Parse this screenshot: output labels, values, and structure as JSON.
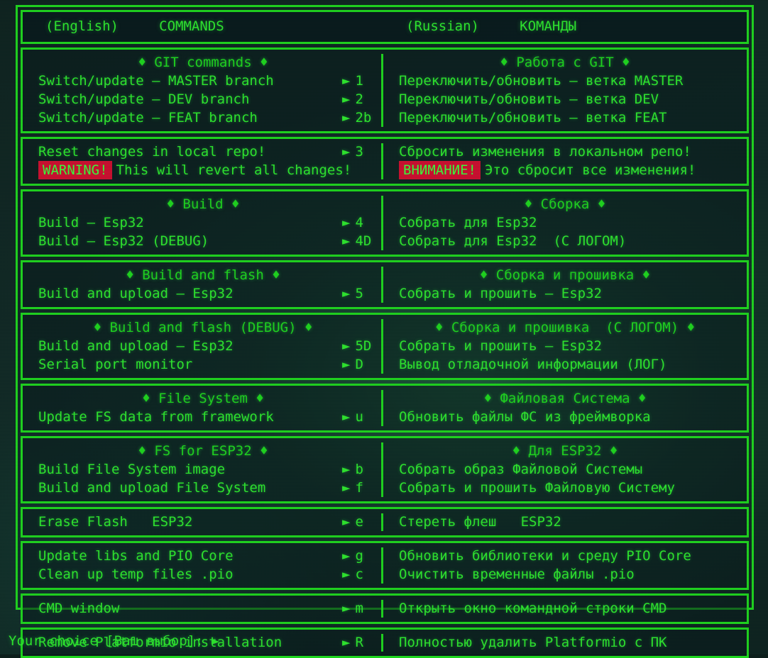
{
  "colors": {
    "border": "#1fd51f",
    "text": "#2ee62e",
    "badge_bg": "#cc1030",
    "badge_text": "#3dfb3d",
    "background": "#102522"
  },
  "glyphs": {
    "arrow": "►",
    "diamond": "♦",
    "dash": "—"
  },
  "header": {
    "left_lang": "(English)",
    "left_title": "COMMANDS",
    "right_lang": "(Russian)",
    "right_title": "КОМАНДЫ"
  },
  "sections": [
    {
      "id": "git",
      "left_title": "♦ GIT commands ♦",
      "right_title": "♦ Работа с GIT ♦",
      "rows": [
        {
          "left": "Switch/update — MASTER branch",
          "key": "1",
          "right": "Переключить/обновить — ветка MASTER"
        },
        {
          "left": "Switch/update — DEV branch",
          "key": "2",
          "right": "Переключить/обновить — ветка DEV"
        },
        {
          "left": "Switch/update — FEAT branch",
          "key": "2b",
          "right": "Переключить/обновить — ветка FEAT"
        }
      ]
    },
    {
      "id": "reset",
      "left_title": "",
      "right_title": "",
      "rows": [
        {
          "left": "Reset changes in local repo!",
          "key": "3",
          "right": "Сбросить изменения в локальном репо!"
        }
      ],
      "warning": {
        "left_badge": "WARNING!",
        "left_text": "This will revert all changes!",
        "right_badge": "ВНИМАНИЕ!",
        "right_text": "Это сбросит все изменения!"
      }
    },
    {
      "id": "build",
      "left_title": "♦ Build ♦",
      "right_title": "♦ Сборка ♦",
      "rows": [
        {
          "left": "Build — Esp32",
          "key": "4",
          "right": "Собрать для Esp32"
        },
        {
          "left": "Build — Esp32 (DEBUG)",
          "key": "4D",
          "right": "Собрать для Esp32  (С ЛОГОМ)"
        }
      ]
    },
    {
      "id": "build-and-flash",
      "left_title": "♦ Build and flash ♦",
      "right_title": "♦ Сборка и прошивка ♦",
      "rows": [
        {
          "left": "Build and upload — Esp32",
          "key": "5",
          "right": "Собрать и прошить — Esp32"
        }
      ]
    },
    {
      "id": "build-and-flash-debug",
      "left_title": "♦ Build and flash (DEBUG) ♦",
      "right_title": "♦ Сборка и прошивка  (С ЛОГОМ) ♦",
      "rows": [
        {
          "left": "Build and upload — Esp32",
          "key": "5D",
          "right": "Собрать и прошить — Esp32"
        },
        {
          "left": "Serial port monitor",
          "key": "D",
          "right": "Вывод отладочной информации (ЛОГ)"
        }
      ]
    },
    {
      "id": "file-system",
      "left_title": "♦ File System ♦",
      "right_title": "♦ Файловая Система ♦",
      "rows": [
        {
          "left": "Update FS data from framework",
          "key": "u",
          "right": "Обновить файлы ФС из фреймворка"
        }
      ]
    },
    {
      "id": "fs-for-esp32",
      "left_title": "♦ FS for ESP32 ♦",
      "right_title": "♦ Для ESP32 ♦",
      "rows": [
        {
          "left": "Build File System image",
          "key": "b",
          "right": "Собрать образ Файловой Системы"
        },
        {
          "left": "Build and upload File System",
          "key": "f",
          "right": "Собрать и прошить Файловую Систему"
        }
      ]
    },
    {
      "id": "erase-flash",
      "left_title": "",
      "right_title": "",
      "rows": [
        {
          "left": "Erase Flash   ESP32",
          "key": "e",
          "right": "Стереть флеш   ESP32"
        }
      ]
    },
    {
      "id": "maintenance",
      "left_title": "",
      "right_title": "",
      "rows": [
        {
          "left": "Update libs and PIO Core",
          "key": "g",
          "right": "Обновить библиотеки и среду PIO Core"
        },
        {
          "left": "Clean up temp files .pio",
          "key": "c",
          "right": "Очистить временные файлы .pio"
        }
      ]
    },
    {
      "id": "cmd-window",
      "left_title": "",
      "right_title": "",
      "rows": [
        {
          "left": "CMD window",
          "key": "m",
          "right": "Открыть окно командной строки CMD"
        }
      ]
    },
    {
      "id": "remove-platformio",
      "left_title": "",
      "right_title": "",
      "rows": [
        {
          "left": "Remove Platformio installation",
          "key": "R",
          "right": "Полностью удалить Platformio с ПК"
        }
      ]
    }
  ],
  "prompt": {
    "text": "Your choice [Ваш выбор]: ►"
  }
}
